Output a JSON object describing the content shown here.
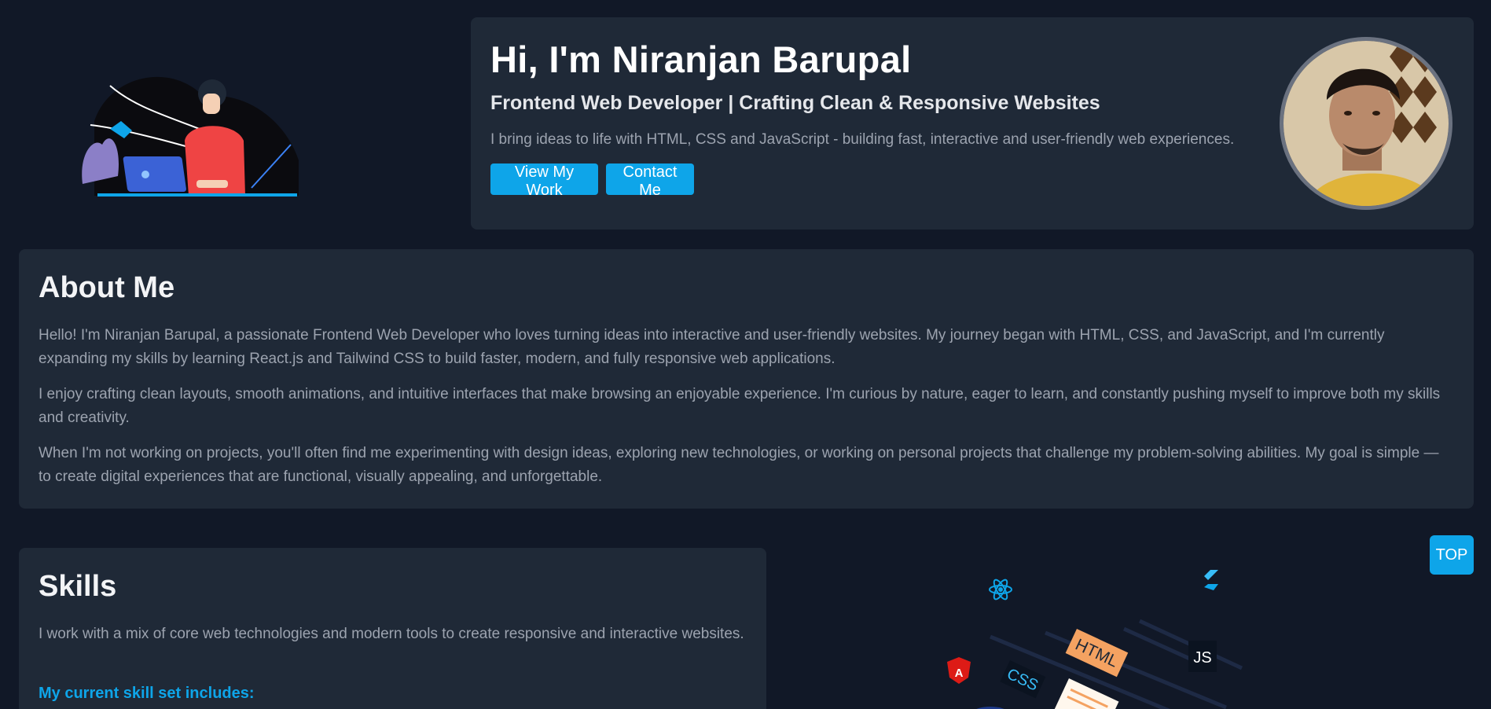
{
  "hero": {
    "title": "Hi, I'm Niranjan Barupal",
    "subtitle": "Frontend Web Developer | Crafting Clean & Responsive Websites",
    "description": "I bring ideas to life with HTML, CSS and JavaScript - building fast, interactive and user-friendly web experiences.",
    "view_work_label": "View My Work",
    "contact_label": "Contact Me",
    "illustration_icon": "developer-laptop-illustration",
    "avatar_icon": "profile-photo"
  },
  "about": {
    "title": "About Me",
    "paragraphs": [
      "Hello! I'm Niranjan Barupal, a passionate Frontend Web Developer who loves turning ideas into interactive and user-friendly websites. My journey began with HTML, CSS, and JavaScript, and I'm currently expanding my skills by learning React.js and Tailwind CSS to build faster, modern, and fully responsive web applications.",
      "I enjoy crafting clean layouts, smooth animations, and intuitive interfaces that make browsing an enjoyable experience. I'm curious by nature, eager to learn, and constantly pushing myself to improve both my skills and creativity.",
      "When I'm not working on projects, you'll often find me experimenting with design ideas, exploring new technologies, or working on personal projects that challenge my problem-solving abilities. My goal is simple — to create digital experiences that are functional, visually appealing, and unforgettable."
    ]
  },
  "skills": {
    "title": "Skills",
    "description": "I work with a mix of core web technologies and modern tools to create responsive and interactive websites.",
    "subheading": "My current skill set includes:",
    "illustration": {
      "html_label": "HTML",
      "css_label": "CSS",
      "js_label": "JS",
      "icons": [
        "react-icon",
        "flutter-icon",
        "angular-icon"
      ]
    }
  },
  "top_button_label": "TOP",
  "colors": {
    "background": "#111827",
    "card": "#1f2937",
    "accent": "#0ea5e9",
    "heading": "#ffffff",
    "body_text": "#9ca3af"
  }
}
